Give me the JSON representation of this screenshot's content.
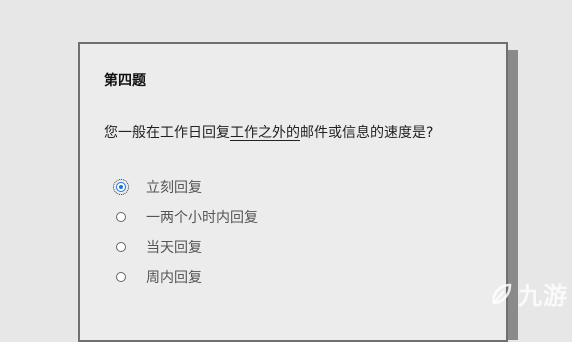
{
  "question": {
    "title": "第四题",
    "text_before": "您一般在工作日回复",
    "text_underlined": "工作之外的",
    "text_after": "邮件或信息的速度是?"
  },
  "options": [
    {
      "label": "立刻回复",
      "checked": true
    },
    {
      "label": "一两个小时内回复",
      "checked": false
    },
    {
      "label": "当天回复",
      "checked": false
    },
    {
      "label": "周内回复",
      "checked": false
    }
  ],
  "watermark": {
    "text": "九游",
    "icon": "leaf-logo-icon"
  },
  "colors": {
    "accent": "#1a73e8",
    "background": "#e7e7e7",
    "card": "#ececec"
  }
}
